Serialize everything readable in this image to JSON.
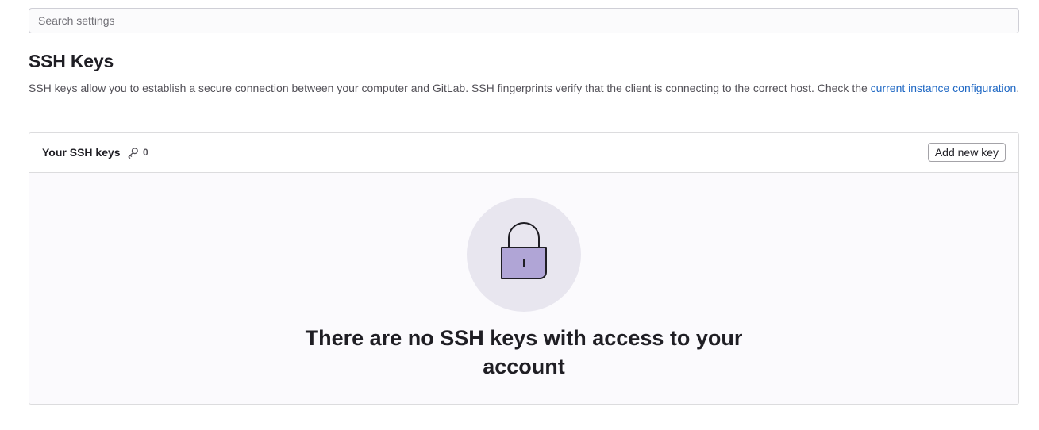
{
  "search": {
    "placeholder": "Search settings"
  },
  "section": {
    "title": "SSH Keys",
    "description": "SSH keys allow you to establish a secure connection between your computer and GitLab. SSH fingerprints verify that the client is connecting to the correct host. Check the ",
    "link_text": "current instance configuration",
    "description_end": "."
  },
  "card": {
    "title": "Your SSH keys",
    "count_icon": "key-icon",
    "count": "0",
    "add_button_label": "Add new key"
  },
  "empty_state": {
    "illustration_icon": "lock-icon",
    "title": "There are no SSH keys with access to your account"
  },
  "colors": {
    "link": "#1f68c4",
    "illustration_bg": "#e8e6ef",
    "lock_fill": "#b0a5d6"
  }
}
